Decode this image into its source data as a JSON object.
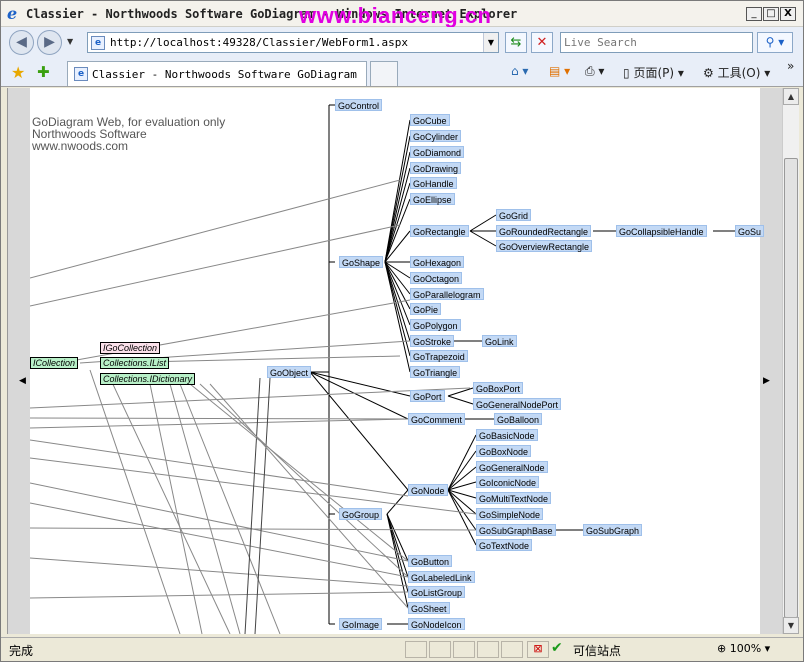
{
  "window": {
    "title": "Classier - Northwoods Software GoDiagram - Windows Internet Explorer",
    "overlay_watermark": "www.bianceng.cn",
    "min_label": "_",
    "max_label": "□",
    "close_label": "X"
  },
  "nav": {
    "back_icon": "back-arrow-icon",
    "forward_icon": "forward-arrow-icon",
    "address": "http://localhost:49328/Classier/WebForm1.aspx",
    "search_placeholder": "Live Search"
  },
  "tabs": [
    {
      "label": "Classier - Northwoods Software GoDiagram"
    }
  ],
  "commands": {
    "page": "页面(P)",
    "tools": "工具(O)",
    "more": "»"
  },
  "diagram": {
    "watermark_lines": [
      "GoDiagram Web, for evaluation only",
      "Northwoods Software",
      "www.nwoods.com"
    ],
    "nodes": [
      {
        "id": "GoControl",
        "label": "GoControl"
      },
      {
        "id": "GoCube",
        "label": "GoCube"
      },
      {
        "id": "GoCylinder",
        "label": "GoCylinder"
      },
      {
        "id": "GoDiamond",
        "label": "GoDiamond"
      },
      {
        "id": "GoDrawing",
        "label": "GoDrawing"
      },
      {
        "id": "GoHandle",
        "label": "GoHandle"
      },
      {
        "id": "GoEllipse",
        "label": "GoEllipse"
      },
      {
        "id": "GoGrid",
        "label": "GoGrid"
      },
      {
        "id": "GoRectangle",
        "label": "GoRectangle"
      },
      {
        "id": "GoRoundedRectangle",
        "label": "GoRoundedRectangle"
      },
      {
        "id": "GoCollapsibleHandle",
        "label": "GoCollapsibleHandle"
      },
      {
        "id": "GoSub",
        "label": "GoSu"
      },
      {
        "id": "GoOverviewRectangle",
        "label": "GoOverviewRectangle"
      },
      {
        "id": "GoShape",
        "label": "GoShape"
      },
      {
        "id": "GoHexagon",
        "label": "GoHexagon"
      },
      {
        "id": "GoOctagon",
        "label": "GoOctagon"
      },
      {
        "id": "GoParallelogram",
        "label": "GoParallelogram"
      },
      {
        "id": "GoPie",
        "label": "GoPie"
      },
      {
        "id": "GoPolygon",
        "label": "GoPolygon"
      },
      {
        "id": "GoStroke",
        "label": "GoStroke"
      },
      {
        "id": "GoLink",
        "label": "GoLink"
      },
      {
        "id": "GoTrapezoid",
        "label": "GoTrapezoid"
      },
      {
        "id": "GoObject",
        "label": "GoObject"
      },
      {
        "id": "GoTriangle",
        "label": "GoTriangle"
      },
      {
        "id": "GoPort",
        "label": "GoPort"
      },
      {
        "id": "GoBoxPort",
        "label": "GoBoxPort"
      },
      {
        "id": "GoGeneralNodePort",
        "label": "GoGeneralNodePort"
      },
      {
        "id": "GoComment",
        "label": "GoComment"
      },
      {
        "id": "GoBalloon",
        "label": "GoBalloon"
      },
      {
        "id": "GoBasicNode",
        "label": "GoBasicNode"
      },
      {
        "id": "GoBoxNode",
        "label": "GoBoxNode"
      },
      {
        "id": "GoGeneralNode",
        "label": "GoGeneralNode"
      },
      {
        "id": "GoNode",
        "label": "GoNode"
      },
      {
        "id": "GoIconicNode",
        "label": "GoIconicNode"
      },
      {
        "id": "GoMultiTextNode",
        "label": "GoMultiTextNode"
      },
      {
        "id": "GoSimpleNode",
        "label": "GoSimpleNode"
      },
      {
        "id": "GoGroup",
        "label": "GoGroup"
      },
      {
        "id": "GoSubGraphBase",
        "label": "GoSubGraphBase"
      },
      {
        "id": "GoSubGraph",
        "label": "GoSubGraph"
      },
      {
        "id": "GoTextNode",
        "label": "GoTextNode"
      },
      {
        "id": "GoButton",
        "label": "GoButton"
      },
      {
        "id": "GoLabeledLink",
        "label": "GoLabeledLink"
      },
      {
        "id": "GoListGroup",
        "label": "GoListGroup"
      },
      {
        "id": "GoSheet",
        "label": "GoSheet"
      },
      {
        "id": "GoImage",
        "label": "GoImage"
      },
      {
        "id": "GoNodeIcon",
        "label": "GoNodeIcon"
      }
    ],
    "interfaces": [
      {
        "id": "ICollection",
        "label": "ICollection",
        "color": "#b8f0c8"
      },
      {
        "id": "IGoCollection",
        "label": "IGoCollection",
        "color": "#fbe0ea"
      },
      {
        "id": "CollectionsIList",
        "label": "Collections.IList",
        "color": "#b8f0c8"
      },
      {
        "id": "CollectionsIDictionary",
        "label": "Collections.IDictionary",
        "color": "#b8f0c8"
      }
    ]
  },
  "status": {
    "text": "完成",
    "zone": "可信站点",
    "zoom": "100%"
  },
  "colors": {
    "node_fill": "#c3d9f5",
    "title_watermark": "#e000e0"
  }
}
